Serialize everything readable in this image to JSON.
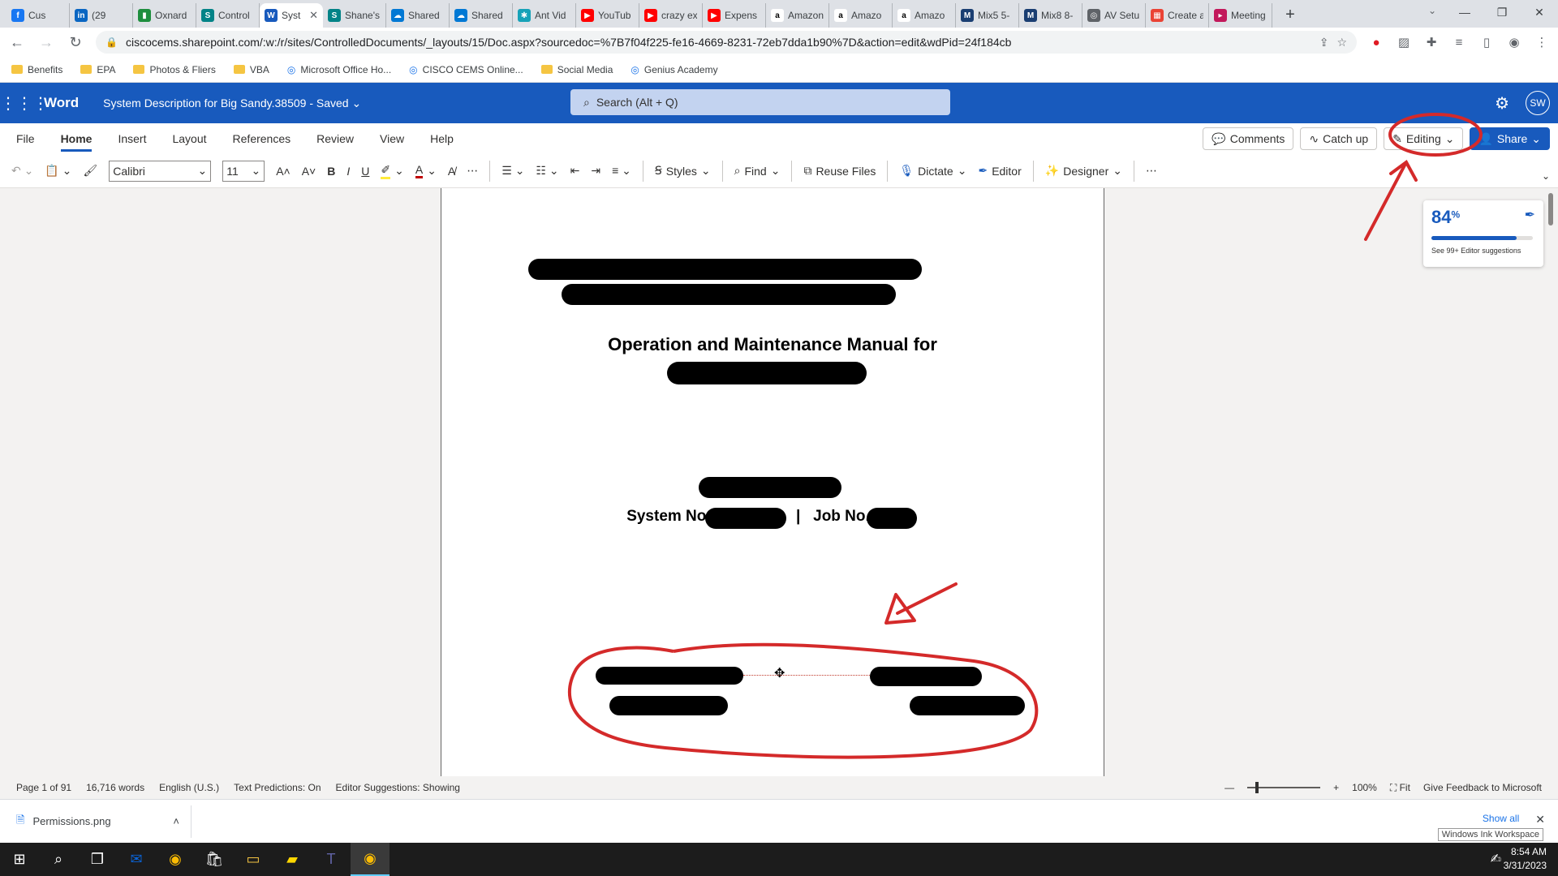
{
  "browser": {
    "tabs": [
      {
        "label": "Cus",
        "color": "#1877f2",
        "glyph": "f"
      },
      {
        "label": "(29",
        "color": "#0a66c2",
        "glyph": "in"
      },
      {
        "label": "Oxnard",
        "color": "#1e8e3e",
        "glyph": "▮"
      },
      {
        "label": "Control",
        "color": "#038387",
        "glyph": "S"
      },
      {
        "label": "Syst",
        "color": "#185abd",
        "glyph": "W",
        "active": true
      },
      {
        "label": "Shane's",
        "color": "#038387",
        "glyph": "S"
      },
      {
        "label": "Shared",
        "color": "#0078d4",
        "glyph": "☁"
      },
      {
        "label": "Shared",
        "color": "#0078d4",
        "glyph": "☁"
      },
      {
        "label": "Ant Vid",
        "color": "#17a2b8",
        "glyph": "✱"
      },
      {
        "label": "YouTub",
        "color": "#ff0000",
        "glyph": "▶"
      },
      {
        "label": "crazy ex",
        "color": "#ff0000",
        "glyph": "▶"
      },
      {
        "label": "Expens",
        "color": "#ff0000",
        "glyph": "▶"
      },
      {
        "label": "Amazon",
        "color": "#ffffff",
        "glyph": "a"
      },
      {
        "label": "Amazo",
        "color": "#ffffff",
        "glyph": "a"
      },
      {
        "label": "Amazo",
        "color": "#ffffff",
        "glyph": "a"
      },
      {
        "label": "Mix5 5-",
        "color": "#1a3e72",
        "glyph": "M"
      },
      {
        "label": "Mix8 8-",
        "color": "#1a3e72",
        "glyph": "M"
      },
      {
        "label": "AV Setu",
        "color": "#5f6368",
        "glyph": "◎"
      },
      {
        "label": "Create a",
        "color": "#ea4335",
        "glyph": "▦"
      },
      {
        "label": "Meeting",
        "color": "#c2185b",
        "glyph": "▸"
      }
    ],
    "new_tab": "+",
    "url": "ciscocems.sharepoint.com/:w:/r/sites/ControlledDocuments/_layouts/15/Doc.aspx?sourcedoc=%7B7f04f225-fe16-4669-8231-72eb7dda1b90%7D&action=edit&wdPid=24f184cb",
    "bookmarks": [
      {
        "label": "Benefits",
        "type": "folder"
      },
      {
        "label": "EPA",
        "type": "folder"
      },
      {
        "label": "Photos & Fliers",
        "type": "folder"
      },
      {
        "label": "VBA",
        "type": "folder"
      },
      {
        "label": "Microsoft Office Ho...",
        "type": "site"
      },
      {
        "label": "CISCO CEMS Online...",
        "type": "site"
      },
      {
        "label": "Social Media",
        "type": "folder"
      },
      {
        "label": "Genius Academy",
        "type": "site"
      }
    ]
  },
  "word": {
    "brand": "Word",
    "doc_title": "System Description for Big Sandy.38509 - Saved ⌄",
    "search_placeholder": "Search (Alt + Q)",
    "avatar": "SW",
    "ribbon_tabs": [
      "File",
      "Home",
      "Insert",
      "Layout",
      "References",
      "Review",
      "View",
      "Help"
    ],
    "active_tab": "Home",
    "comments_label": "Comments",
    "catchup_label": "Catch up",
    "editing_label": "Editing",
    "share_label": "Share",
    "font_name": "Calibri",
    "font_size": "11",
    "styles_label": "Styles",
    "find_label": "Find",
    "reuse_label": "Reuse Files",
    "dictate_label": "Dictate",
    "editor_label": "Editor",
    "designer_label": "Designer"
  },
  "document": {
    "heading": "Operation and Maintenance Manual for",
    "system_no_label": "System No.",
    "separator": "|",
    "job_no_label": "Job No."
  },
  "editor_panel": {
    "score": "84",
    "score_unit": "%",
    "score_fraction": 0.84,
    "suggestions": "See 99+ Editor suggestions"
  },
  "status": {
    "page": "Page 1 of 91",
    "words": "16,716 words",
    "language": "English (U.S.)",
    "predictions": "Text Predictions: On",
    "suggestions": "Editor Suggestions: Showing",
    "zoom": "100%",
    "fit": "Fit",
    "feedback": "Give Feedback to Microsoft"
  },
  "downloads": {
    "file": "Permissions.png",
    "show_all": "Show all"
  },
  "taskbar": {
    "time": "8:54 AM",
    "date": "3/31/2023",
    "ink_tooltip": "Windows Ink Workspace"
  },
  "colors": {
    "word_blue": "#185abd",
    "annotation_red": "#d42a2a"
  }
}
